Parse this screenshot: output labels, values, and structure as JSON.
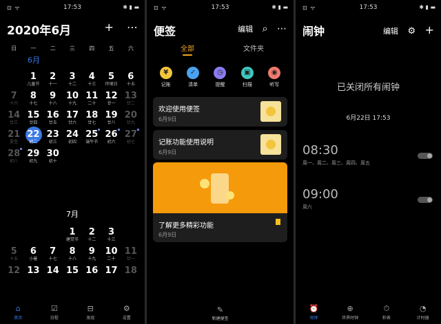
{
  "status": {
    "time": "17:53",
    "left_icons": "⊡ ᯤ",
    "right_icons": "✱ ▮ ▬"
  },
  "calendar": {
    "title": "2020年6月",
    "actions": {
      "add": "+",
      "more": "⋯"
    },
    "weekdays": [
      "日",
      "一",
      "二",
      "三",
      "四",
      "五",
      "六"
    ],
    "month_june": "6月",
    "month_july": "7月",
    "june_rows": [
      [
        {
          "n": "",
          "s": ""
        },
        {
          "n": "1",
          "s": "儿童节"
        },
        {
          "n": "2",
          "s": "十一"
        },
        {
          "n": "3",
          "s": "十二"
        },
        {
          "n": "4",
          "s": "十三"
        },
        {
          "n": "5",
          "s": "环境日"
        },
        {
          "n": "6",
          "s": "十五"
        }
      ],
      [
        {
          "n": "7",
          "s": "十六",
          "dim": true
        },
        {
          "n": "8",
          "s": "十七"
        },
        {
          "n": "9",
          "s": "十八"
        },
        {
          "n": "10",
          "s": "十九"
        },
        {
          "n": "11",
          "s": "二十"
        },
        {
          "n": "12",
          "s": "廿一"
        },
        {
          "n": "13",
          "s": "廿二",
          "dim": true
        }
      ],
      [
        {
          "n": "14",
          "s": "廿三",
          "dim": true
        },
        {
          "n": "15",
          "s": "廿四"
        },
        {
          "n": "16",
          "s": "廿五"
        },
        {
          "n": "17",
          "s": "廿六"
        },
        {
          "n": "18",
          "s": "廿七"
        },
        {
          "n": "19",
          "s": "廿八"
        },
        {
          "n": "20",
          "s": "廿九",
          "dim": true
        }
      ],
      [
        {
          "n": "21",
          "s": "夏至",
          "dim": true
        },
        {
          "n": "22",
          "s": "初二",
          "today": true
        },
        {
          "n": "23",
          "s": "初三"
        },
        {
          "n": "24",
          "s": "初四"
        },
        {
          "n": "25",
          "s": "端午节",
          "dot": true
        },
        {
          "n": "26",
          "s": "初六",
          "dot": true
        },
        {
          "n": "27",
          "s": "初七",
          "dim": true,
          "dot": true
        }
      ],
      [
        {
          "n": "28",
          "s": "初八",
          "dim": true,
          "dot": true
        },
        {
          "n": "29",
          "s": "初九"
        },
        {
          "n": "30",
          "s": "初十"
        },
        {
          "n": "",
          "s": ""
        },
        {
          "n": "",
          "s": ""
        },
        {
          "n": "",
          "s": ""
        },
        {
          "n": "",
          "s": ""
        }
      ]
    ],
    "july_rows": [
      [
        {
          "n": "",
          "s": ""
        },
        {
          "n": "",
          "s": ""
        },
        {
          "n": "",
          "s": ""
        },
        {
          "n": "1",
          "s": "建党节"
        },
        {
          "n": "2",
          "s": "十二"
        },
        {
          "n": "3",
          "s": "十三"
        },
        {
          "n": "",
          "s": ""
        }
      ],
      [
        {
          "n": "5",
          "s": "十五",
          "dim": true
        },
        {
          "n": "6",
          "s": "小暑"
        },
        {
          "n": "7",
          "s": "十七"
        },
        {
          "n": "8",
          "s": "十八"
        },
        {
          "n": "9",
          "s": "十九"
        },
        {
          "n": "10",
          "s": "二十"
        },
        {
          "n": "11",
          "s": "廿一",
          "dim": true
        }
      ],
      [
        {
          "n": "12",
          "s": "",
          "dim": true
        },
        {
          "n": "13",
          "s": ""
        },
        {
          "n": "14",
          "s": ""
        },
        {
          "n": "15",
          "s": ""
        },
        {
          "n": "16",
          "s": ""
        },
        {
          "n": "17",
          "s": ""
        },
        {
          "n": "18",
          "s": "",
          "dim": true
        }
      ]
    ],
    "tabs": [
      {
        "icon": "⌂",
        "label": "首页",
        "active": true
      },
      {
        "icon": "☑",
        "label": "日程"
      },
      {
        "icon": "⊟",
        "label": "发现"
      },
      {
        "icon": "⚙",
        "label": "设置"
      }
    ]
  },
  "notes": {
    "title": "便签",
    "edit": "编辑",
    "search": "⌕",
    "more": "⋯",
    "tab_all": "全部",
    "tab_folder": "文件夹",
    "tools": [
      {
        "icon": "¥",
        "label": "记账",
        "color": "#f2c53d"
      },
      {
        "icon": "✓",
        "label": "清单",
        "color": "#4aa3f0"
      },
      {
        "icon": "◷",
        "label": "提醒",
        "color": "#8a7cf0"
      },
      {
        "icon": "▣",
        "label": "扫描",
        "color": "#3fc7c0"
      },
      {
        "icon": "◉",
        "label": "听写",
        "color": "#f07a6e"
      }
    ],
    "cards": [
      {
        "title": "欢迎使用便签",
        "date": "6月9日"
      },
      {
        "title": "记账功能使用说明",
        "date": "6月9日"
      }
    ],
    "feature": {
      "title": "了解更多精彩功能",
      "date": "6月9日"
    },
    "new_note": {
      "icon": "✎",
      "label": "新建便签"
    }
  },
  "alarm": {
    "title": "闹钟",
    "edit": "编辑",
    "settings": "⚙",
    "add": "+",
    "status": "已关闭所有闹钟",
    "now": "6月22日 17:53",
    "alarms": [
      {
        "time": "08:30",
        "days": "周一、周二、周三、周四、周五"
      },
      {
        "time": "09:00",
        "days": "周六"
      }
    ],
    "tabs": [
      {
        "icon": "⏰",
        "label": "闹钟",
        "active": true
      },
      {
        "icon": "⊕",
        "label": "世界时钟"
      },
      {
        "icon": "⏱",
        "label": "秒表"
      },
      {
        "icon": "◔",
        "label": "计时器"
      }
    ]
  }
}
